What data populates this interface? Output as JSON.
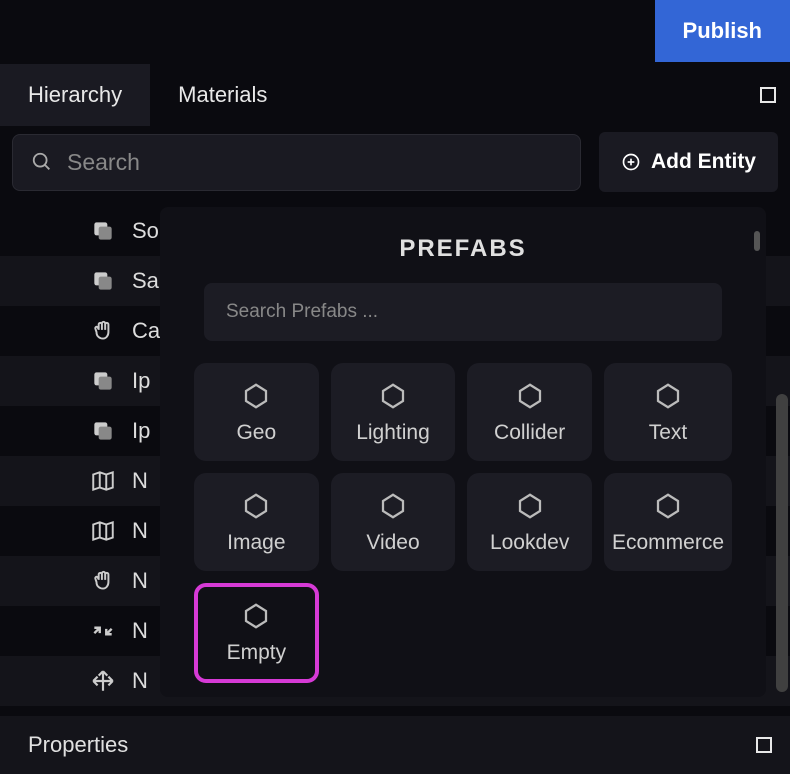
{
  "topbar": {
    "publish_label": "Publish"
  },
  "tabs": {
    "hierarchy_label": "Hierarchy",
    "materials_label": "Materials"
  },
  "search": {
    "placeholder": "Search"
  },
  "add_entity": {
    "label": "Add Entity"
  },
  "hierarchy_items": [
    {
      "label": "Sony_LV",
      "icon": "stack"
    },
    {
      "label": "Sa",
      "icon": "stack"
    },
    {
      "label": "Ca",
      "icon": "hand"
    },
    {
      "label": "Ip",
      "icon": "stack"
    },
    {
      "label": "Ip",
      "icon": "stack"
    },
    {
      "label": "N",
      "icon": "map"
    },
    {
      "label": "N",
      "icon": "map"
    },
    {
      "label": "N",
      "icon": "hand"
    },
    {
      "label": "N",
      "icon": "shrink"
    },
    {
      "label": "N",
      "icon": "axes"
    }
  ],
  "prefabs": {
    "title": "PREFABS",
    "search_placeholder": "Search Prefabs ...",
    "items": [
      {
        "label": "Geo"
      },
      {
        "label": "Lighting"
      },
      {
        "label": "Collider"
      },
      {
        "label": "Text"
      },
      {
        "label": "Image"
      },
      {
        "label": "Video"
      },
      {
        "label": "Lookdev"
      },
      {
        "label": "Ecommerce"
      },
      {
        "label": "Empty",
        "highlighted": true
      }
    ]
  },
  "properties": {
    "title": "Properties"
  }
}
